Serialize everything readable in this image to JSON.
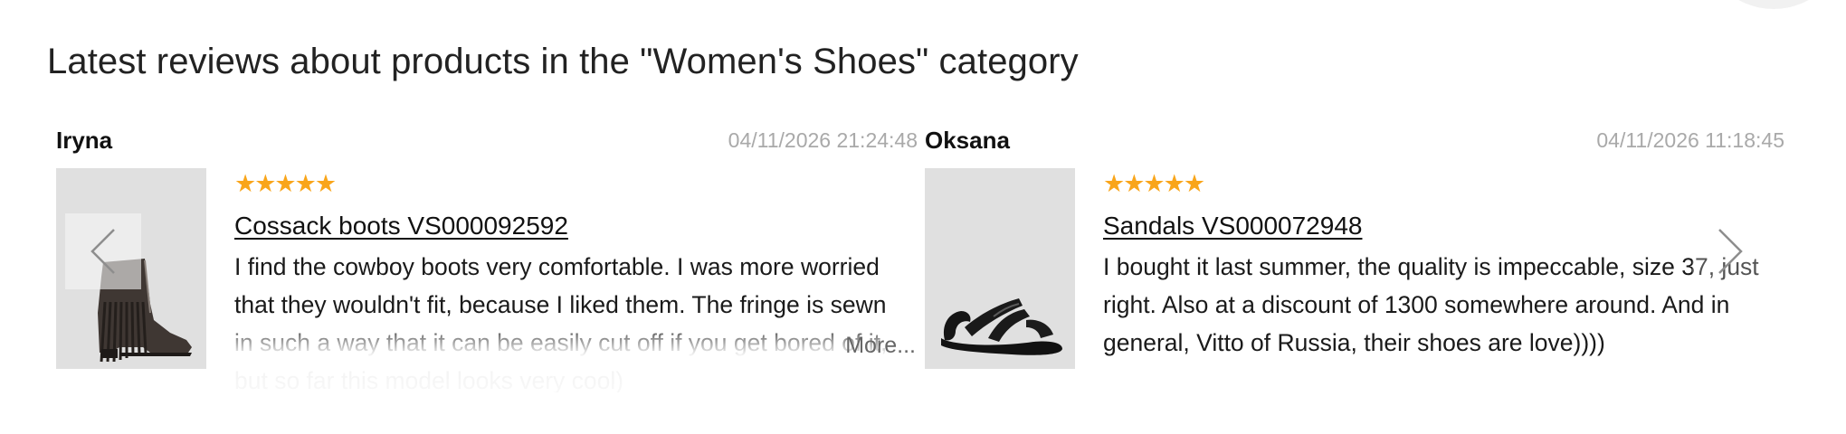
{
  "section": {
    "title": "Latest reviews about products in the \"Women's Shoes\" category"
  },
  "colors": {
    "star": "#f9a51a",
    "date": "#a9a9a9",
    "image_bg": "#e0e0e0"
  },
  "reviews": [
    {
      "name": "Iryna",
      "date": "04/11/2026 21:24:48",
      "rating": 5,
      "stars": "★★★★★",
      "product": "Cossack boots VS000092592",
      "product_icon": "fringe-ankle-boot",
      "text": "I find the cowboy boots very comfortable. I was more worried that they wouldn't fit, because I liked them. The fringe is sewn in such a way that it can be easily cut off if you get bored of it, but so far this model looks very cool)",
      "more_label": "More..."
    },
    {
      "name": "Oksana",
      "date": "04/11/2026 11:18:45",
      "rating": 5,
      "stars": "★★★★★",
      "product": "Sandals VS000072948",
      "product_icon": "black-sandal",
      "text": "I bought it last summer, the quality is impeccable, size 37, just right. Also at a discount of 1300 somewhere around. And in general, Vitto of Russia, their shoes are love))))"
    }
  ],
  "carousel": {
    "prev_icon": "chevron-left-icon",
    "next_icon": "chevron-right-icon"
  }
}
